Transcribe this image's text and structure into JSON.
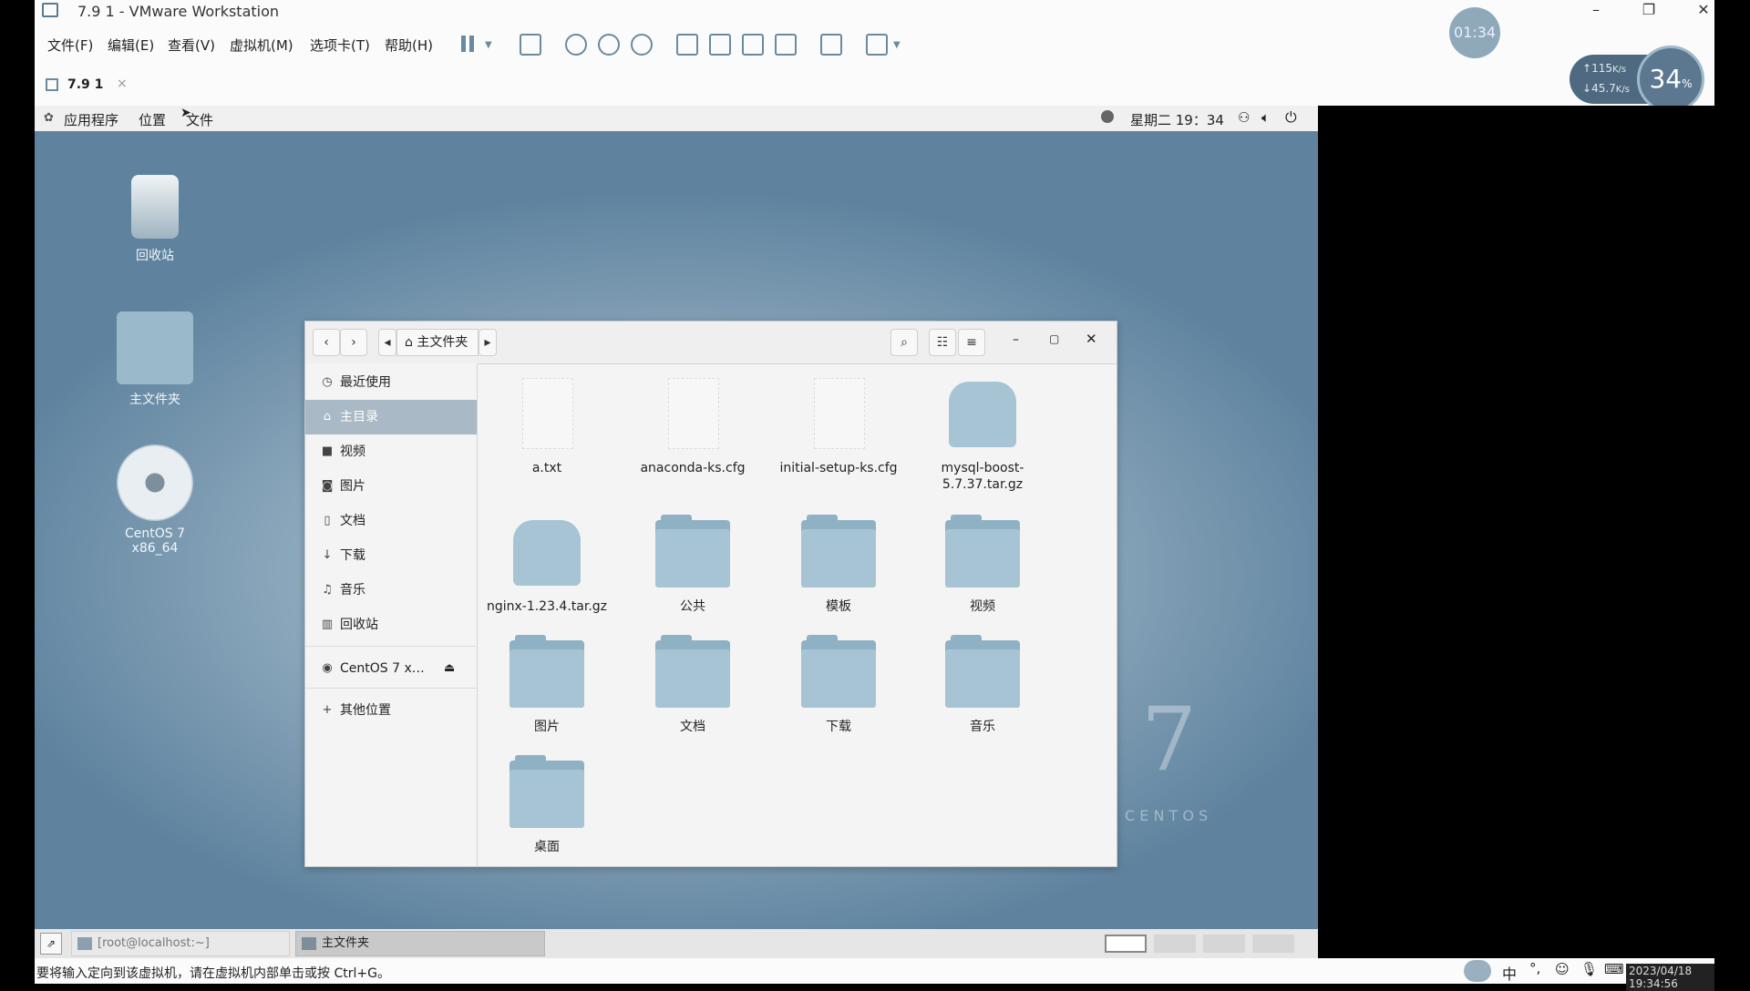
{
  "vmware": {
    "window_title": "7.9 1 - VMware Workstation",
    "menus": [
      "文件(F)",
      "编辑(E)",
      "查看(V)",
      "虚拟机(M)",
      "选项卡(T)",
      "帮助(H)"
    ],
    "tab_label": "7.9 1",
    "tab_close": "×",
    "timer": "01:34",
    "net_up": "115",
    "net_up_unit": "K/s",
    "net_down": "45.7",
    "net_down_unit": "K/s",
    "cpu_percent": "34",
    "cpu_unit": "%",
    "status_message": "要将输入定向到该虚拟机，请在虚拟机内部单击或按 Ctrl+G。"
  },
  "guest_top": {
    "applications": "应用程序",
    "places": "位置",
    "files": "文件",
    "clock": "星期二 19：34"
  },
  "desktop_icons": [
    "回收站",
    "主文件夹",
    "CentOS 7 x86_64"
  ],
  "centos_brand": "7",
  "centos_text": "C E N T O S",
  "file_manager": {
    "path_label": "主文件夹",
    "sidebar": [
      {
        "label": "最近使用",
        "icon": "clock-icon"
      },
      {
        "label": "主目录",
        "icon": "home-icon"
      },
      {
        "label": "视频",
        "icon": "video-icon"
      },
      {
        "label": "图片",
        "icon": "camera-icon"
      },
      {
        "label": "文档",
        "icon": "document-icon"
      },
      {
        "label": "下载",
        "icon": "download-icon"
      },
      {
        "label": "音乐",
        "icon": "music-icon"
      },
      {
        "label": "回收站",
        "icon": "trash-icon"
      },
      {
        "label": "CentOS 7 x…",
        "icon": "disc-icon"
      },
      {
        "label": "其他位置",
        "icon": "plus-icon"
      }
    ],
    "files": [
      {
        "name": "a.txt",
        "type": "doc"
      },
      {
        "name": "anaconda-ks.cfg",
        "type": "doc"
      },
      {
        "name": "initial-setup-ks.cfg",
        "type": "doc"
      },
      {
        "name": "mysql-boost-5.7.37.tar.gz",
        "type": "archive"
      },
      {
        "name": "nginx-1.23.4.tar.gz",
        "type": "archive"
      },
      {
        "name": "公共",
        "type": "folder"
      },
      {
        "name": "模板",
        "type": "folder"
      },
      {
        "name": "视频",
        "type": "folder"
      },
      {
        "name": "图片",
        "type": "folder"
      },
      {
        "name": "文档",
        "type": "folder"
      },
      {
        "name": "下载",
        "type": "folder"
      },
      {
        "name": "音乐",
        "type": "folder"
      },
      {
        "name": "桌面",
        "type": "folder"
      }
    ]
  },
  "guest_taskbar": {
    "terminal": "[root@localhost:~]",
    "files": "主文件夹"
  },
  "host_tray": {
    "ime": "中",
    "datetime": "2023/04/18 19:34:56"
  }
}
